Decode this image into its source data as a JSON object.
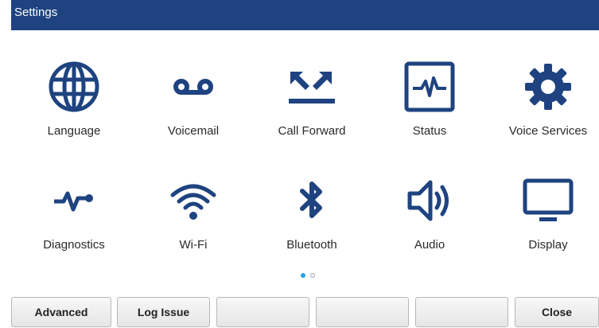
{
  "window": {
    "title": "Settings"
  },
  "tiles": [
    {
      "label": "Language",
      "icon": "globe-icon"
    },
    {
      "label": "Voicemail",
      "icon": "voicemail-icon"
    },
    {
      "label": "Call Forward",
      "icon": "call-forward-icon"
    },
    {
      "label": "Status",
      "icon": "status-pulse-icon"
    },
    {
      "label": "Voice Services",
      "icon": "gear-icon"
    },
    {
      "label": "Diagnostics",
      "icon": "diagnostics-icon"
    },
    {
      "label": "Wi-Fi",
      "icon": "wifi-icon"
    },
    {
      "label": "Bluetooth",
      "icon": "bluetooth-icon"
    },
    {
      "label": "Audio",
      "icon": "speaker-icon"
    },
    {
      "label": "Display",
      "icon": "monitor-icon"
    }
  ],
  "pager": {
    "current_page": 1,
    "total_pages": 2
  },
  "softkeys": [
    "Advanced",
    "Log Issue",
    "",
    "",
    "",
    "Close"
  ],
  "colors": {
    "header_bg": "#1e4380",
    "icon": "#1e4380",
    "pager_active": "#1ca6e8"
  }
}
